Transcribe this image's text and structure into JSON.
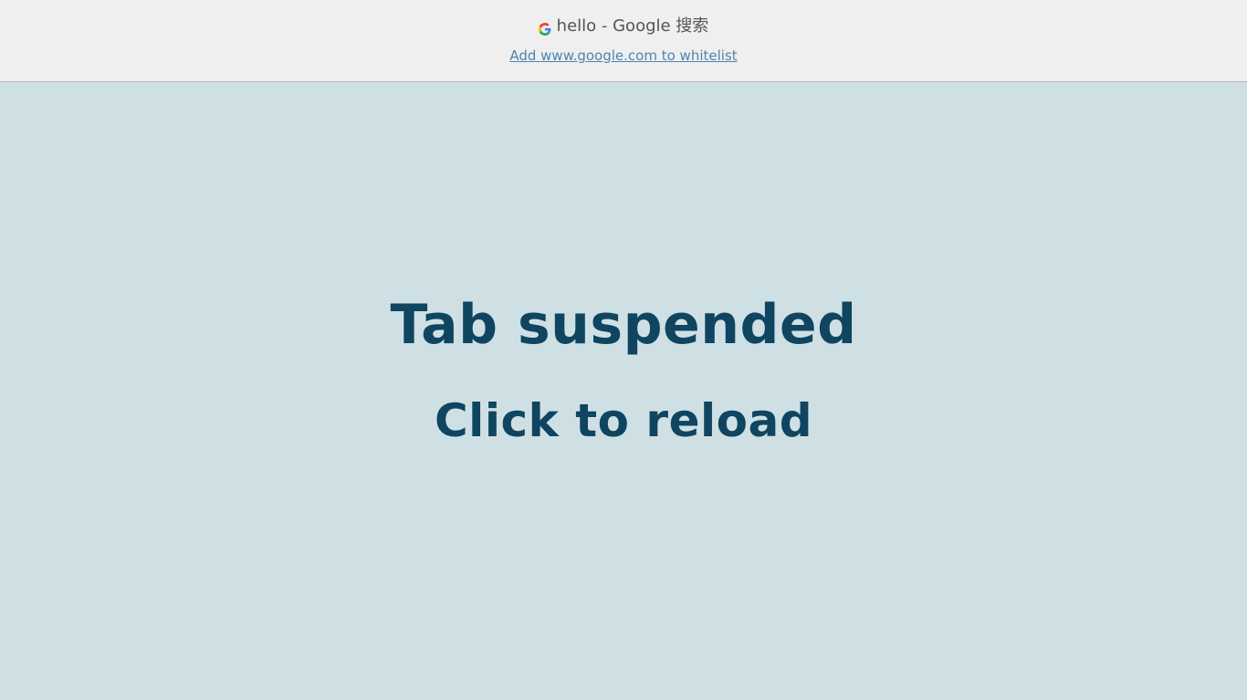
{
  "header": {
    "favicon_icon": "google-g-icon",
    "page_title": "hello - Google 搜索",
    "whitelist_link": "Add www.google.com to whitelist"
  },
  "main": {
    "heading": "Tab suspended",
    "subheading": "Click to reload"
  },
  "colors": {
    "background": "#cfe0e5",
    "header_background": "#efefef",
    "title_text": "#555555",
    "link": "#4f84ad",
    "heading_text": "#0f4560"
  }
}
